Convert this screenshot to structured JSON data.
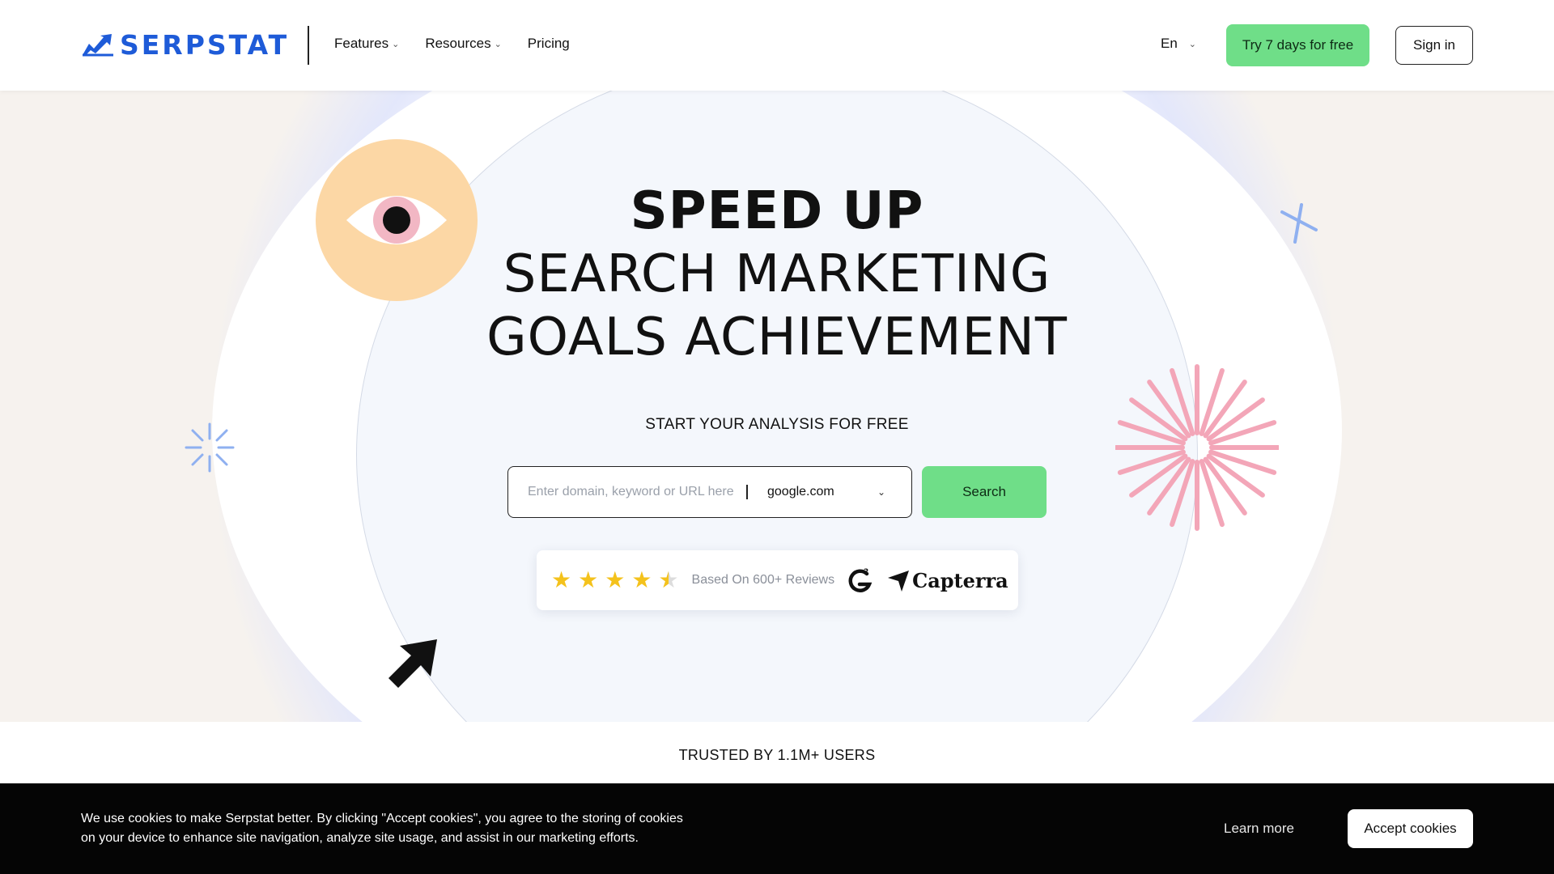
{
  "brand": {
    "name": "SERPSTAT",
    "color": "#1e5bd8"
  },
  "nav": {
    "items": [
      {
        "label": "Features",
        "has_dropdown": true
      },
      {
        "label": "Resources",
        "has_dropdown": true
      },
      {
        "label": "Pricing",
        "has_dropdown": false
      }
    ],
    "language": "En",
    "try_label": "Try 7 days for free",
    "sign_in_label": "Sign in"
  },
  "hero": {
    "title_line1": "SPEED UP",
    "title_line2": "SEARCH MARKETING",
    "title_line3": "GOALS ACHIEVEMENT",
    "subtitle": "START YOUR ANALYSIS FOR FREE",
    "search": {
      "placeholder": "Enter domain, keyword or URL here",
      "engine": "google.com",
      "button_label": "Search"
    },
    "reviews": {
      "rating": 4.5,
      "max_rating": 5,
      "text": "Based On 600+ Reviews",
      "platforms": [
        "G2",
        "Capterra"
      ]
    }
  },
  "trusted": {
    "text": "TRUSTED BY 1.1M+ USERS"
  },
  "cookie": {
    "line1": "We use cookies to make Serpstat better. By clicking \"Accept cookies\", you agree to the storing of cookies",
    "line2": "on your device to enhance site navigation, analyze site usage, and assist in our marketing efforts.",
    "learn_more": "Learn more",
    "accept_label": "Accept cookies"
  },
  "colors": {
    "accent_green": "#6fde88",
    "star_yellow": "#f4c21c",
    "eye_orange": "#fcd7a5",
    "burst_pink": "#f3a6b8",
    "burst_blue": "#8fb0f0"
  }
}
